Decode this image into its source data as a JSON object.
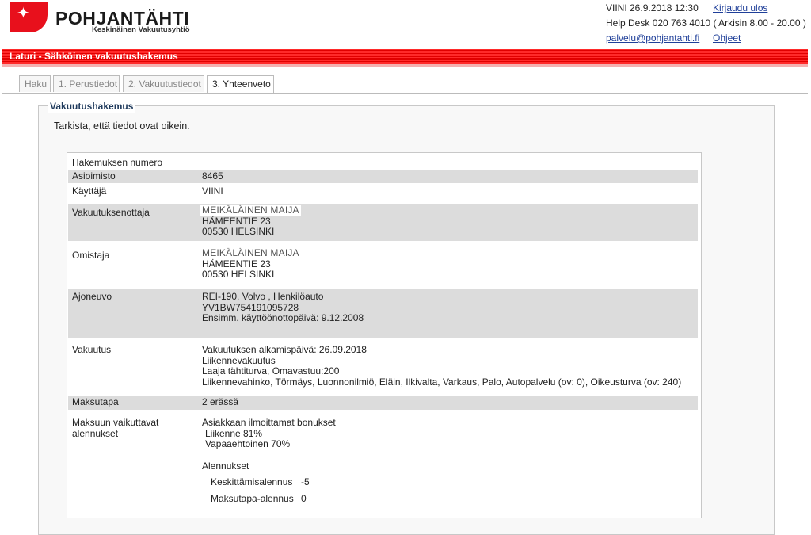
{
  "logo": {
    "name": "POHJANTÄHTI",
    "subtitle": "Keskinäinen Vakuutusyhtiö"
  },
  "header": {
    "user_time": "VIINI 26.9.2018 12:30",
    "logout": "Kirjaudu ulos",
    "helpdesk": "Help Desk 020 763 4010",
    "hours": "( Arkisin 8.00 - 20.00 )",
    "email": "palvelu@pohjantahti.fi",
    "help": "Ohjeet"
  },
  "titlebar": "Laturi - Sähköinen vakuutushakemus",
  "tabs": [
    "Haku",
    "1. Perustiedot",
    "2. Vakuutustiedot",
    "3. Yhteenveto"
  ],
  "active_tab": "3. Yhteenveto",
  "panel": {
    "legend": "Vakuutushakemus",
    "instruction": "Tarkista, että tiedot ovat oikein."
  },
  "rows": {
    "hakemus": {
      "label": "Hakemuksen numero",
      "value": ""
    },
    "asioimisto": {
      "label": "Asioimisto",
      "value": "8465"
    },
    "kayttaja": {
      "label": "Käyttäjä",
      "value": "VIINI"
    },
    "ottaja": {
      "label": "Vakuutuksenottaja",
      "name": "MEIKÄLÄINEN MAIJA",
      "address": "HÄMEENTIE 23",
      "city": "00530 HELSINKI"
    },
    "omistaja": {
      "label": "Omistaja",
      "name": "MEIKÄLÄINEN MAIJA",
      "address": "HÄMEENTIE 23",
      "city": "00530 HELSINKI"
    },
    "ajoneuvo": {
      "label": "Ajoneuvo",
      "line1": "REI-190, Volvo , Henkilöauto",
      "line2": "YV1BW754191095728",
      "line3": "Ensimm. käyttöönottopäivä: 9.12.2008"
    },
    "vakuutus": {
      "label": "Vakuutus",
      "line1": "Vakuutuksen alkamispäivä: 26.09.2018",
      "line2": "Liikennevakuutus",
      "line3": "Laaja tähtiturva, Omavastuu:200",
      "line4": "Liikennevahinko, Törmäys, Luonnonilmiö, Eläin, Ilkivalta, Varkaus, Palo, Autopalvelu (ov: 0), Oikeusturva (ov: 240)"
    },
    "maksutapa": {
      "label": "Maksutapa",
      "value": "2 erässä"
    },
    "alennukset": {
      "label1": "Maksuun vaikuttavat",
      "label2": "alennukset",
      "bonus_title": "Asiakkaan ilmoittamat bonukset",
      "bonus1": "Liikenne 81%",
      "bonus2": "Vapaaehtoinen 70%",
      "discounts_title": "Alennukset",
      "d1_label": "Keskittämisalennus",
      "d1_value": "-5",
      "d2_label": "Maksutapa-alennus",
      "d2_value": "0"
    }
  },
  "colors": {
    "brand_red": "#e8101c",
    "link_blue": "#1f3f99",
    "legend_blue": "#1f3a5c",
    "row_shade": "#dcdcdc"
  }
}
